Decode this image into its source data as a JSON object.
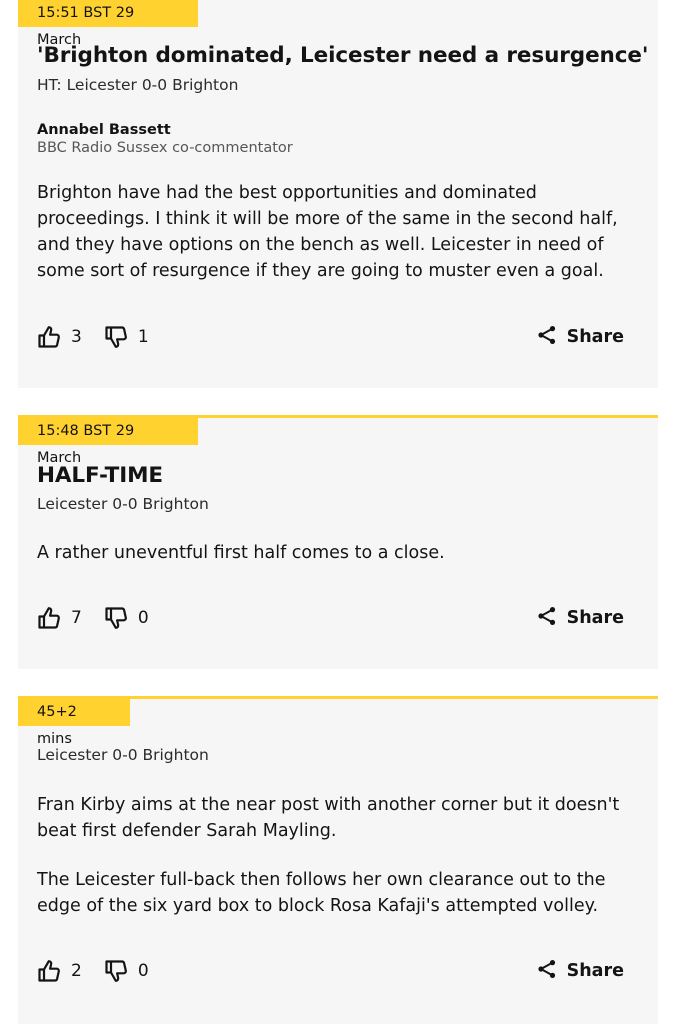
{
  "posts": [
    {
      "timestamp": "15:51 BST 29 March",
      "title": "'Brighton dominated, Leicester need a resurgence'",
      "score": "HT: Leicester 0-0 Brighton",
      "author": "Annabel Bassett",
      "role": "BBC Radio Sussex co-commentator",
      "body": "Brighton have had the best opportunities and dominated proceedings. I think it will be more of the same in the second half, and they have options on the bench as well. Leicester in need of some sort of resurgence if they are going to muster even a goal.",
      "likes": "3",
      "dislikes": "1",
      "share_label": "Share"
    },
    {
      "timestamp": "15:48 BST 29 March",
      "title": "HALF-TIME",
      "score": "Leicester 0-0 Brighton",
      "body": "A rather uneventful first half comes to a close.",
      "likes": "7",
      "dislikes": "0",
      "share_label": "Share"
    },
    {
      "timestamp": "45+2 mins",
      "score": "Leicester 0-0 Brighton",
      "body_paragraphs": [
        "Fran Kirby aims at the near post with another corner but it doesn't beat first defender Sarah Mayling.",
        "The Leicester full-back then follows her own clearance out to the edge of the six yard box to block Rosa Kafaji's attempted volley."
      ],
      "likes": "2",
      "dislikes": "0",
      "share_label": "Share"
    }
  ],
  "icons": {
    "like": "thumbs-up-icon",
    "dislike": "thumbs-down-icon",
    "share": "share-icon"
  },
  "colors": {
    "accent": "#ffd230",
    "card_background": "#f6f6f6",
    "text": "#141414",
    "muted_text": "#545658"
  }
}
